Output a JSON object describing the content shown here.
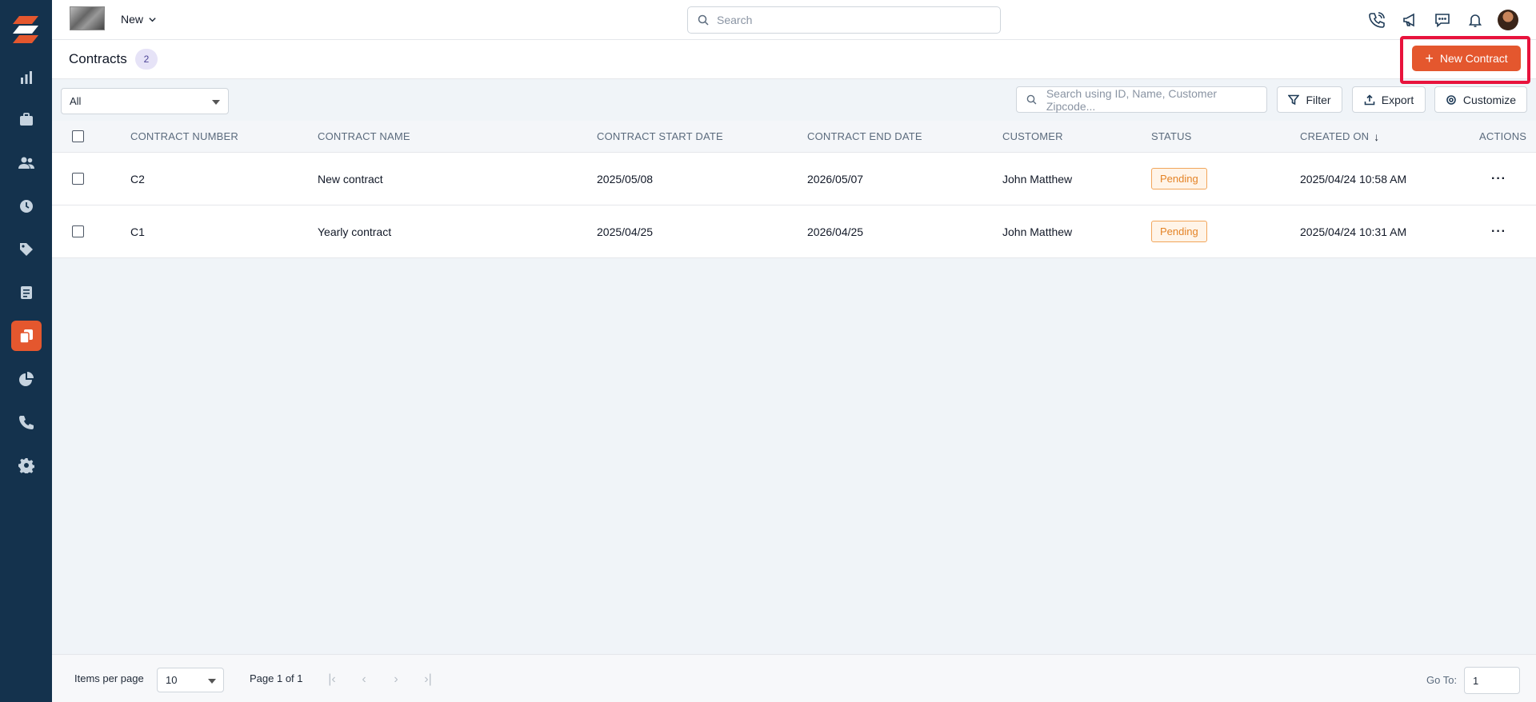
{
  "sidebar": {
    "items": [
      {
        "icon": "dashboard-chart-icon"
      },
      {
        "icon": "briefcase-icon"
      },
      {
        "icon": "users-icon"
      },
      {
        "icon": "clock-icon"
      },
      {
        "icon": "tag-icon"
      },
      {
        "icon": "invoice-icon"
      },
      {
        "icon": "contracts-icon",
        "active": true
      },
      {
        "icon": "pie-chart-icon"
      },
      {
        "icon": "phone-icon"
      },
      {
        "icon": "gear-icon"
      }
    ]
  },
  "topbar": {
    "new_label": "New",
    "search_placeholder": "Search"
  },
  "header": {
    "title": "Contracts",
    "count": "2",
    "new_contract_label": "New Contract"
  },
  "toolbar": {
    "filter_select_value": "All",
    "search_placeholder": "Search using ID, Name, Customer Zipcode...",
    "filter_label": "Filter",
    "export_label": "Export",
    "customize_label": "Customize"
  },
  "table": {
    "columns": [
      "CONTRACT NUMBER",
      "CONTRACT NAME",
      "CONTRACT START DATE",
      "CONTRACT END DATE",
      "CUSTOMER",
      "STATUS",
      "CREATED ON",
      "ACTIONS"
    ],
    "rows": [
      {
        "number": "C2",
        "name": "New contract",
        "start": "2025/05/08",
        "end": "2026/05/07",
        "customer": "John Matthew",
        "status": "Pending",
        "created": "2025/04/24 10:58 AM"
      },
      {
        "number": "C1",
        "name": "Yearly contract",
        "start": "2025/04/25",
        "end": "2026/04/25",
        "customer": "John Matthew",
        "status": "Pending",
        "created": "2025/04/24 10:31 AM"
      }
    ]
  },
  "footer": {
    "items_per_page_label": "Items per page",
    "items_per_page_value": "10",
    "page_info": "Page 1 of 1",
    "goto_label": "Go To:",
    "goto_value": "1"
  },
  "colors": {
    "sidebar": "#14324d",
    "accent": "#e4572e",
    "highlight": "#e8133c",
    "pending": "#e48326"
  }
}
